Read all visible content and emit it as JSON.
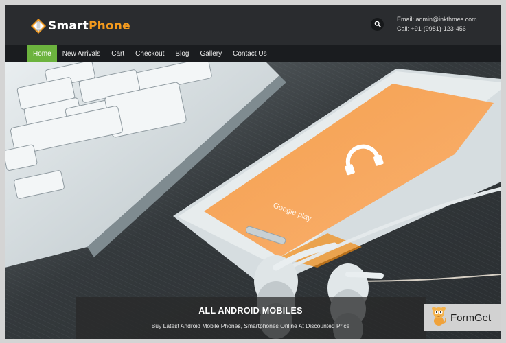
{
  "header": {
    "logo": {
      "part1": "Smart",
      "part2": "Phone"
    },
    "search_icon": "search-icon",
    "contact": {
      "email": "Email: admin@inkthmes.com",
      "phone": "Call: +91-(9981)-123-456"
    }
  },
  "nav": {
    "items": [
      {
        "label": "Home",
        "active": true
      },
      {
        "label": "New Arrivals",
        "active": false
      },
      {
        "label": "Cart",
        "active": false
      },
      {
        "label": "Checkout",
        "active": false
      },
      {
        "label": "Blog",
        "active": false
      },
      {
        "label": "Gallery",
        "active": false
      },
      {
        "label": "Contact Us",
        "active": false
      }
    ]
  },
  "hero": {
    "phone_screen_text": "Google play",
    "caption": {
      "title": "ALL ANDROID MOBILES",
      "subtitle": "Buy Latest Android Mobile Phones, Smartphones Online At Discounted Price"
    }
  },
  "badge": {
    "label": "FormGet"
  },
  "colors": {
    "accent_green": "#6cb33e",
    "brand_orange": "#f39a1e",
    "header_bg": "#2a2c2f",
    "nav_bg": "#1a1c1f",
    "screen_orange": "#f7a24e"
  }
}
